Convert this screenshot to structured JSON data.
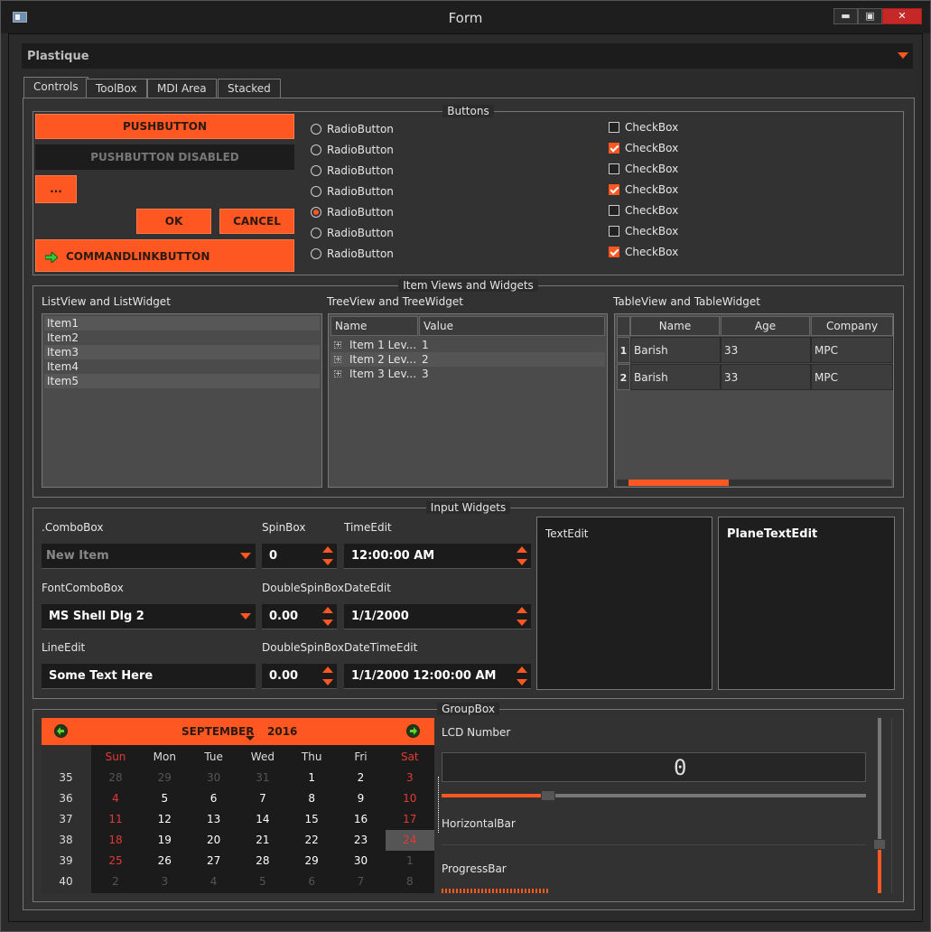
{
  "window": {
    "title": "Form",
    "minimize": "▬",
    "maximize": "▣",
    "close": "✕"
  },
  "style_combo": {
    "value": "Plastique"
  },
  "tabs": [
    {
      "label": "Controls"
    },
    {
      "label": "ToolBox"
    },
    {
      "label": "MDI Area"
    },
    {
      "label": "Stacked"
    }
  ],
  "buttons_group": {
    "title": "Buttons",
    "pushbutton": "PUSHBUTTON",
    "pushbutton_disabled": "PUSHBUTTON DISABLED",
    "ellipsis": "...",
    "ok": "OK",
    "cancel": "CANCEL",
    "commandlink": "COMMANDLINKBUTTON",
    "radios": [
      {
        "label": "RadioButton",
        "checked": false
      },
      {
        "label": "RadioButton",
        "checked": false
      },
      {
        "label": "RadioButton",
        "checked": false
      },
      {
        "label": "RadioButton",
        "checked": false
      },
      {
        "label": "RadioButton",
        "checked": true
      },
      {
        "label": "RadioButton",
        "checked": false
      },
      {
        "label": "RadioButton",
        "checked": false
      }
    ],
    "checks": [
      {
        "label": "CheckBox",
        "checked": false
      },
      {
        "label": "CheckBox",
        "checked": true
      },
      {
        "label": "CheckBox",
        "checked": false
      },
      {
        "label": "CheckBox",
        "checked": true
      },
      {
        "label": "CheckBox",
        "checked": false
      },
      {
        "label": "CheckBox",
        "checked": false
      },
      {
        "label": "CheckBox",
        "checked": true
      }
    ]
  },
  "item_views": {
    "title": "Item Views and Widgets",
    "list": {
      "label": "ListView and ListWidget",
      "items": [
        "Item1",
        "Item2",
        "Item3",
        "Item4",
        "Item5"
      ]
    },
    "tree": {
      "label": "TreeView and TreeWidget",
      "headers": [
        "Name",
        "Value"
      ],
      "rows": [
        {
          "name": "Item 1 Lev...",
          "value": "1"
        },
        {
          "name": "Item 2 Lev...",
          "value": "2"
        },
        {
          "name": "Item 3 Lev...",
          "value": "3"
        }
      ]
    },
    "table": {
      "label": "TableView and TableWidget",
      "headers": [
        "Name",
        "Age",
        "Company"
      ],
      "rows": [
        {
          "num": "1",
          "name": "Barish",
          "age": "33",
          "company": "MPC"
        },
        {
          "num": "2",
          "name": "Barish",
          "age": "33",
          "company": "MPC"
        }
      ]
    }
  },
  "input_widgets": {
    "title": "Input Widgets",
    "combobox": {
      "label": ".ComboBox",
      "value": "New Item"
    },
    "fontcombo": {
      "label": "FontComboBox",
      "value": "MS Shell Dlg 2"
    },
    "lineedit": {
      "label": "LineEdit",
      "value": "Some Text Here"
    },
    "spinbox": {
      "label": "SpinBox",
      "value": "0"
    },
    "doublespin1": {
      "label": "DoubleSpinBox",
      "value": "0.00"
    },
    "doublespin2": {
      "label": "DoubleSpinBox",
      "value": "0.00"
    },
    "timeedit": {
      "label": "TimeEdit",
      "value": "12:00:00 AM"
    },
    "dateedit": {
      "label": "DateEdit",
      "value": "1/1/2000"
    },
    "datetimeedit": {
      "label": "DateTimeEdit",
      "value": "1/1/2000 12:00:00 AM"
    },
    "textedit": {
      "value": "TextEdit"
    },
    "plaintextedit": {
      "value": "PlaneTextEdit"
    }
  },
  "groupbox": {
    "title": "GroupBox",
    "calendar": {
      "month": "SEPTEMBER",
      "year": "2016",
      "days": [
        "Sun",
        "Mon",
        "Tue",
        "Wed",
        "Thu",
        "Fri",
        "Sat"
      ],
      "weeks": [
        {
          "wk": "35",
          "d": [
            "28",
            "29",
            "30",
            "31",
            "1",
            "2",
            "3"
          ]
        },
        {
          "wk": "36",
          "d": [
            "4",
            "5",
            "6",
            "7",
            "8",
            "9",
            "10"
          ]
        },
        {
          "wk": "37",
          "d": [
            "11",
            "12",
            "13",
            "14",
            "15",
            "16",
            "17"
          ]
        },
        {
          "wk": "38",
          "d": [
            "18",
            "19",
            "20",
            "21",
            "22",
            "23",
            "24"
          ]
        },
        {
          "wk": "39",
          "d": [
            "25",
            "26",
            "27",
            "28",
            "29",
            "30",
            "1"
          ]
        },
        {
          "wk": "40",
          "d": [
            "2",
            "3",
            "4",
            "5",
            "6",
            "7",
            "8"
          ]
        }
      ],
      "selected": "24"
    },
    "lcd_label": "LCD Number",
    "lcd_value": "0",
    "slider_value": 0.25,
    "hbar_label": "HorizontalBar",
    "progress_label": "ProgressBar",
    "progress_value": 0.25,
    "vslider_value": 0.25
  },
  "colors": {
    "accent": "#ff5722",
    "bg": "#2b2b2b",
    "weekend": "#e53935"
  }
}
